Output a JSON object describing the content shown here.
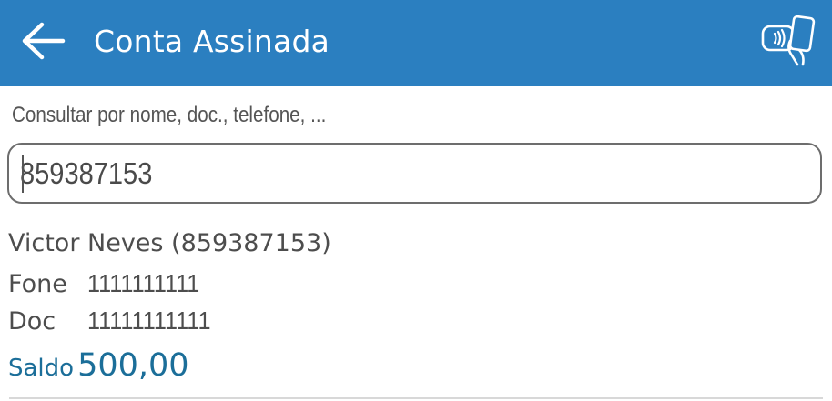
{
  "header": {
    "title": "Conta Assinada",
    "back_icon": "arrow-left-icon",
    "action_icon": "contactless-payment-icon",
    "color": "#2b7fc0"
  },
  "search": {
    "label": "Consultar por nome, doc., telefone, ...",
    "value": "859387153"
  },
  "result": {
    "name": "Victor Neves (859387153)",
    "fone_label": "Fone",
    "fone_value": "1111111111",
    "doc_label": "Doc",
    "doc_value": "11111111111",
    "saldo_label": "Saldo",
    "saldo_value": "500,00",
    "saldo_color": "#1b6e99"
  }
}
